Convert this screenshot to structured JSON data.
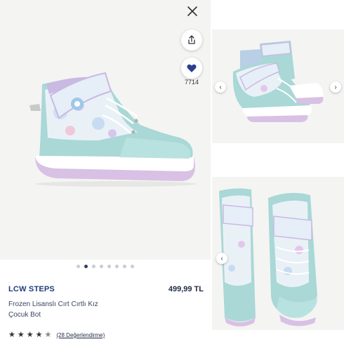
{
  "actions": {
    "favorite_count": "7714"
  },
  "gallery": {
    "dots_count": 8,
    "active_dot_index": 1
  },
  "product": {
    "brand": "LCW STEPS",
    "price": "499,99 TL",
    "title_line1": "Frozen Lisanslı Cırt Cırtlı Kız",
    "title_line2": "Çocuk Bot",
    "rating": 4.5,
    "review_link": "(28 Değerlendirme)"
  },
  "thumbnails": {
    "prev_arrow": "‹",
    "next_arrow": "›"
  },
  "colors": {
    "brand_text": "#1f3a7a",
    "heart": "#2a3f8f",
    "boot_body": "#a9d8d6",
    "sole": "#c9a7d8"
  }
}
